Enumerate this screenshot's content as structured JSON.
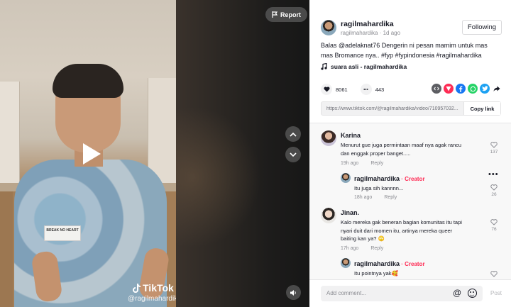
{
  "video": {
    "report_label": "Report",
    "watermark_brand": "TikTok",
    "watermark_handle": "@ragilmahardika",
    "shirt_text": "BREAK NO HEART"
  },
  "post": {
    "author_name": "ragilmahardika",
    "author_handle": "ragilmahardika",
    "separator": " · ",
    "posted_ago": "1d ago",
    "follow_label": "Following",
    "description_prefix": "Balas ",
    "mention": "@adelaknat76",
    "description_body": " Dengerin ni pesan mamim untuk mas mas Bromance nya.. ",
    "hashtags": "#fyp #fypindonesia #ragilmahardika",
    "music": "suara asli - ragilmahardika",
    "likes": "8061",
    "comment_count": "443",
    "link": "https://www.tiktok.com/@ragilmahardika/video/710957032...",
    "copy_label": "Copy link"
  },
  "share_colors": {
    "embed": "#5d5e63",
    "send": "#fe2c55",
    "facebook": "#1877f2",
    "whatsapp": "#25d366",
    "twitter": "#1da1f2",
    "share": "#161823"
  },
  "comments": [
    {
      "name": "Karina",
      "text_line1": "Menurut gue juga permintaan maaf nya agak rancu",
      "text_line2": "dan enggak proper banget.....",
      "time": "19h ago",
      "reply": "Reply",
      "likes": "137"
    },
    {
      "name": "ragilmahardika",
      "badge": " · Creator",
      "text_line1": "Itu juga sih kannnn...",
      "time": "18h ago",
      "reply": "Reply",
      "likes": "26"
    },
    {
      "name": "Jinan.",
      "text_line1": "Kalo mereka gak beneran bagian komunitas itu tapi",
      "text_line2": "nyari duit dari momen itu, artinya mereka queer",
      "text_line3": "baiting kan ya? 🙄",
      "time": "17h ago",
      "reply": "Reply",
      "likes": "76"
    },
    {
      "name": "ragilmahardika",
      "badge": " · Creator",
      "text_line1": "Itu pointnya yak🥰",
      "likes": ""
    }
  ],
  "composer": {
    "placeholder": "Add comment...",
    "at_symbol": "@",
    "post_label": "Post"
  }
}
